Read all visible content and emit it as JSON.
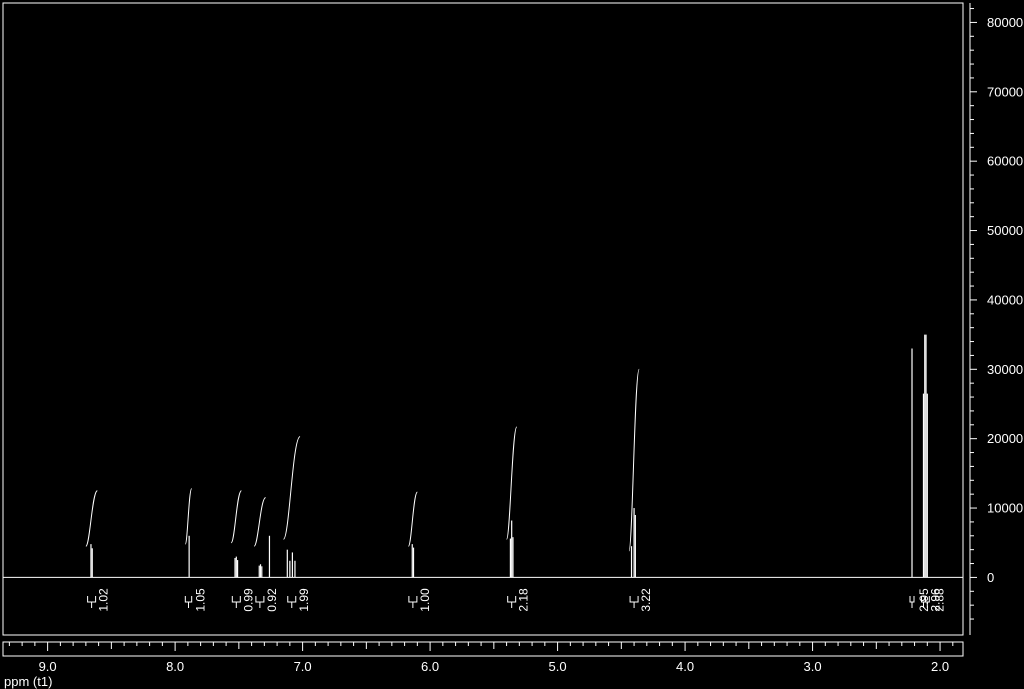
{
  "colors": {
    "background": "#000000",
    "foreground": "#ffffff"
  },
  "chart_data": {
    "type": "line",
    "title": "",
    "xlabel": "ppm (t1)",
    "ylabel": "",
    "x_reversed": true,
    "xlim": [
      9.35,
      1.82
    ],
    "ylim": [
      -8300,
      82800
    ],
    "x_ticks": [
      9.0,
      8.0,
      7.0,
      6.0,
      5.0,
      4.0,
      3.0,
      2.0
    ],
    "x_tick_labels": [
      "9.0",
      "8.0",
      "7.0",
      "6.0",
      "5.0",
      "4.0",
      "3.0",
      "2.0"
    ],
    "y_ticks": [
      0,
      10000,
      20000,
      30000,
      40000,
      50000,
      60000,
      70000,
      80000
    ],
    "y_tick_labels": [
      "0",
      "10000",
      "20000",
      "30000",
      "40000",
      "50000",
      "60000",
      "70000",
      "80000"
    ],
    "grid": false,
    "peaks": [
      {
        "ppm": 8.66,
        "height": 4800
      },
      {
        "ppm": 8.65,
        "height": 4200
      },
      {
        "ppm": 7.89,
        "height": 6000
      },
      {
        "ppm": 7.53,
        "height": 2800
      },
      {
        "ppm": 7.52,
        "height": 3000
      },
      {
        "ppm": 7.51,
        "height": 2500
      },
      {
        "ppm": 7.34,
        "height": 1700
      },
      {
        "ppm": 7.33,
        "height": 1900
      },
      {
        "ppm": 7.32,
        "height": 1600
      },
      {
        "ppm": 7.26,
        "height": 6000
      },
      {
        "ppm": 7.12,
        "height": 4000
      },
      {
        "ppm": 7.1,
        "height": 2400
      },
      {
        "ppm": 7.08,
        "height": 3600
      },
      {
        "ppm": 7.06,
        "height": 2400
      },
      {
        "ppm": 6.14,
        "height": 4800
      },
      {
        "ppm": 6.13,
        "height": 4300
      },
      {
        "ppm": 5.37,
        "height": 5600
      },
      {
        "ppm": 5.36,
        "height": 8200
      },
      {
        "ppm": 5.35,
        "height": 5800
      },
      {
        "ppm": 4.42,
        "height": 4500
      },
      {
        "ppm": 4.4,
        "height": 10000
      },
      {
        "ppm": 4.39,
        "height": 9000
      },
      {
        "ppm": 2.22,
        "height": 33000
      },
      {
        "ppm": 2.13,
        "height": 26500
      },
      {
        "ppm": 2.12,
        "height": 35000
      },
      {
        "ppm": 2.11,
        "height": 35000
      },
      {
        "ppm": 2.1,
        "height": 26500
      }
    ],
    "integrals": [
      {
        "start": 8.7,
        "end": 8.61,
        "value": "1.02",
        "y_start": 4500,
        "y_end": 12500
      },
      {
        "start": 7.92,
        "end": 7.87,
        "value": "1.05",
        "y_start": 4800,
        "y_end": 12800
      },
      {
        "start": 7.56,
        "end": 7.48,
        "value": "0.99",
        "y_start": 5000,
        "y_end": 12500
      },
      {
        "start": 7.38,
        "end": 7.29,
        "value": "0.92",
        "y_start": 4500,
        "y_end": 11500
      },
      {
        "start": 7.15,
        "end": 7.02,
        "value": "1.99",
        "y_start": 5500,
        "y_end": 20300
      },
      {
        "start": 6.17,
        "end": 6.1,
        "value": "1.00",
        "y_start": 4500,
        "y_end": 12300
      },
      {
        "start": 5.4,
        "end": 5.32,
        "value": "2.18",
        "y_start": 5500,
        "y_end": 21700
      },
      {
        "start": 4.44,
        "end": 4.36,
        "value": "3.22",
        "y_start": 3800,
        "y_end": 30000
      },
      {
        "start": 2.23,
        "end": 2.21,
        "value": "2.95",
        "y_start": 0,
        "y_end": 0
      },
      {
        "start": 2.14,
        "end": 2.12,
        "value": "2.96",
        "y_start": 0,
        "y_end": 0
      },
      {
        "start": 2.11,
        "end": 2.09,
        "value": "2.88",
        "y_start": 0,
        "y_end": 0
      }
    ]
  }
}
